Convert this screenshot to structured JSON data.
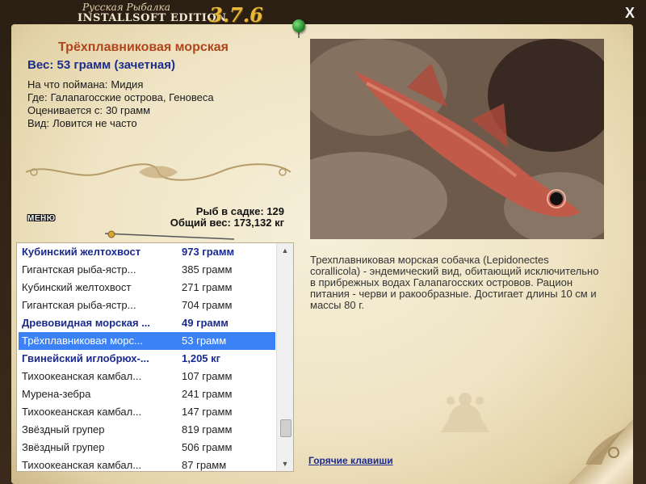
{
  "header": {
    "logo_small": "Русская Рыбалка",
    "logo_main": "INSTALLSOFT EDITION",
    "version": "3.7.6",
    "close_label": "X"
  },
  "fish": {
    "title": "Трёхплавниковая морская",
    "weight": "Вес: 53 грамм (зачетная)",
    "bait_label": "На что поймана:",
    "bait": "Мидия",
    "location_label": "Где:",
    "location": "Галапагосские острова, Геновеса",
    "rated_label": "Оценивается с:",
    "rated": "30 грамм",
    "kind_label": "Вид:",
    "kind": "Ловится не часто"
  },
  "stats": {
    "count_line": "Рыб в садке: 129",
    "total_line": "Общий вес: 173,132 кг"
  },
  "menu_label": "МЕНЮ",
  "catch_list": [
    {
      "name": "Кубинский желтохвост",
      "weight": "973 грамм",
      "style": "bold"
    },
    {
      "name": "Гигантская рыба-ястр...",
      "weight": "385 грамм",
      "style": "normal"
    },
    {
      "name": "Кубинский желтохвост",
      "weight": "271 грамм",
      "style": "normal"
    },
    {
      "name": "Гигантская рыба-ястр...",
      "weight": "704 грамм",
      "style": "normal"
    },
    {
      "name": "Древовидная морская ...",
      "weight": "49 грамм",
      "style": "bold"
    },
    {
      "name": "Трёхплавниковая морс...",
      "weight": "53 грамм",
      "style": "selected"
    },
    {
      "name": "Гвинейский иглобрюх-...",
      "weight": "1,205 кг",
      "style": "bold"
    },
    {
      "name": "Тихоокеанская камбал...",
      "weight": "107 грамм",
      "style": "normal"
    },
    {
      "name": "Мурена-зебра",
      "weight": "241 грамм",
      "style": "normal"
    },
    {
      "name": "Тихоокеанская камбал...",
      "weight": "147 грамм",
      "style": "normal"
    },
    {
      "name": "Звёздный групер",
      "weight": "819 грамм",
      "style": "normal"
    },
    {
      "name": "Звёздный групер",
      "weight": "506 грамм",
      "style": "normal"
    },
    {
      "name": "Тихоокеанская камбал...",
      "weight": "87 грамм",
      "style": "normal"
    }
  ],
  "description": "Трехплавниковая морская собачка (Lepidonectes corallicola) - эндемический вид, обитающий исключительно в прибрежных водах Галапагосских островов. Рацион питания - черви и ракообразные. Достигает длины 10 см и массы 80 г.",
  "hotkeys_label": "Горячие клавиши",
  "colors": {
    "title": "#b0451c",
    "accent_blue": "#1b2a8f",
    "selection": "#3b82f6",
    "version_gold": "#e9b93a"
  }
}
